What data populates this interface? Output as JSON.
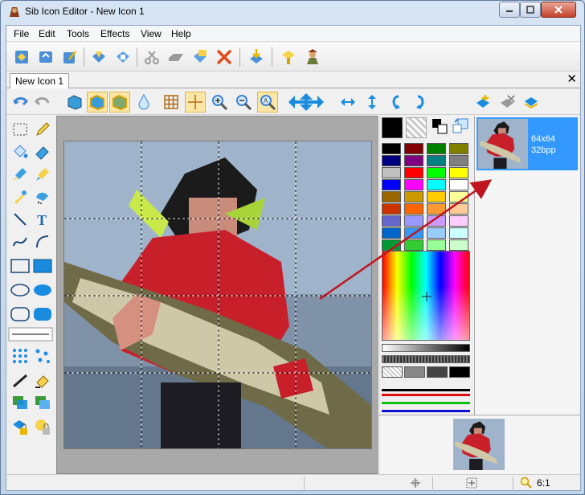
{
  "window": {
    "title": "Sib Icon Editor - New Icon 1",
    "colors": {
      "titlebar": "#c9d9ea",
      "close": "#c4412b",
      "selection": "#3399ff",
      "arrow": "#c0141e"
    }
  },
  "menu": [
    "File",
    "Edit",
    "Tools",
    "Effects",
    "View",
    "Help"
  ],
  "toolbar_icons": [
    "new-icon",
    "open-icon",
    "magic-wand-icon",
    "save-icon",
    "save-as-icon",
    "cut-icon",
    "copy-icon",
    "paste-icon",
    "delete-icon",
    "import-icon",
    "extract-icon",
    "wizard-icon"
  ],
  "document": {
    "tab_label": "New Icon 1",
    "close_glyph": "✕"
  },
  "draw_toolbar_icons": [
    "undo-icon",
    "redo-icon",
    "cube-outline-icon",
    "cube-fill-icon",
    "cube-both-icon",
    "drop-icon",
    "grid-icon",
    "crosshair-icon",
    "zoom-in-icon",
    "zoom-out-icon",
    "zoom-fit-icon",
    "move-icon",
    "flip-h-icon",
    "flip-v-icon",
    "rotate-left-icon",
    "rotate-right-icon",
    "add-format-icon",
    "remove-format-icon",
    "formats-icon"
  ],
  "tools": [
    "select-rect",
    "pencil",
    "fill",
    "eraser",
    "brush",
    "color-replace",
    "dropper",
    "airbrush",
    "line",
    "text",
    "curve",
    "arc",
    "rect-outline",
    "rect-filled",
    "ellipse-outline",
    "ellipse-filled",
    "round-rect-outline",
    "round-rect-filled",
    "line-width",
    "brush-size-1",
    "brush-size-2",
    "pen",
    "gradient",
    "layers",
    "shadow",
    "lock-format",
    "lock-color"
  ],
  "palette": {
    "primary_color": "#000000",
    "secondary_color": "transparent",
    "swatches": [
      "#000000",
      "#800000",
      "#008000",
      "#808000",
      "#000080",
      "#800080",
      "#008080",
      "#808080",
      "#c0c0c0",
      "#ff0000",
      "#00ff00",
      "#ffff00",
      "#0000ff",
      "#ff00ff",
      "#00ffff",
      "#ffffff",
      "#996600",
      "#cc9900",
      "#ffcc00",
      "#ffff99",
      "#cc3300",
      "#ff6600",
      "#ff9933",
      "#ffcc99",
      "#6666cc",
      "#9999ff",
      "#cc99ff",
      "#ffccff",
      "#0066cc",
      "#3399ff",
      "#99ccff",
      "#ccffff",
      "#009933",
      "#33cc33",
      "#99ff99",
      "#ccffcc"
    ]
  },
  "formats": [
    {
      "size": "64x64",
      "depth": "32bpp"
    }
  ],
  "status": {
    "zoom": "6:1"
  }
}
